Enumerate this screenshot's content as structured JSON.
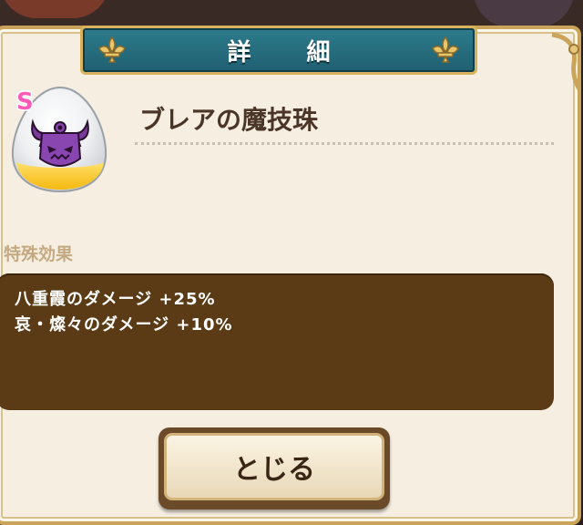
{
  "header": {
    "title": "詳 細"
  },
  "item": {
    "name": "ブレアの魔技珠",
    "rank": "S",
    "icon": "demon-orb-icon"
  },
  "special_effects": {
    "label": "特殊効果",
    "lines": [
      "八重霞のダメージ +25%",
      "哀・燦々のダメージ +10%"
    ]
  },
  "close_button": {
    "label": "とじる"
  },
  "colors": {
    "header_teal": "#2d7c8c",
    "panel_cream": "#f6efe1",
    "gold_border": "#c9a45a",
    "effects_brown": "#5b3b15",
    "label_tan": "#c5a982"
  }
}
